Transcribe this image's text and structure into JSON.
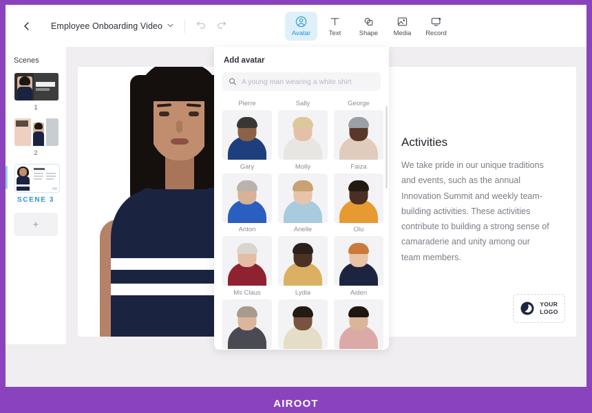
{
  "brand": {
    "name": "AIROOT",
    "frame_color": "#8a43bd"
  },
  "header": {
    "back_icon": "chevron-left-icon",
    "project_title": "Employee Onboarding Video",
    "title_chevron": "chevron-down-icon",
    "undo_icon": "undo-icon",
    "redo_icon": "redo-icon",
    "tools": [
      {
        "label": "Avatar",
        "icon": "avatar-icon",
        "active": true
      },
      {
        "label": "Text",
        "icon": "text-icon",
        "active": false
      },
      {
        "label": "Shape",
        "icon": "shape-icon",
        "active": false
      },
      {
        "label": "Media",
        "icon": "media-icon",
        "active": false
      },
      {
        "label": "Record",
        "icon": "record-icon",
        "active": false
      }
    ],
    "accent_color": "#2b93d6",
    "active_tool_bg": "#dff0fb"
  },
  "scenes": {
    "title": "Scenes",
    "items": [
      {
        "label": "1",
        "active": false
      },
      {
        "label": "2",
        "active": false
      },
      {
        "label": "SCENE 3",
        "active": true
      }
    ],
    "add_label": "+",
    "add_icon": "plus-icon"
  },
  "panel": {
    "title": "Add avatar",
    "search": {
      "icon": "search-icon",
      "value": "",
      "placeholder": "A young man wearing a white shirt"
    },
    "avatars": [
      {
        "name": "Pierre",
        "skin": "#8d6247",
        "hair": "#3a3732",
        "shirt": "#1d3f7e"
      },
      {
        "name": "Sally",
        "skin": "#e5c0a8",
        "hair": "#dcc89a",
        "shirt": "#e8e6e2"
      },
      {
        "name": "George",
        "skin": "#59382a",
        "hair": "#9aa0a8",
        "shirt": "#e0cbbd"
      },
      {
        "name": "Gary",
        "skin": "#d8b196",
        "hair": "#b9b3ab",
        "shirt": "#2a5fc0"
      },
      {
        "name": "Molly",
        "skin": "#e6c3a9",
        "hair": "#c9a172",
        "shirt": "#a8cbe0"
      },
      {
        "name": "Faiza",
        "skin": "#4a3024",
        "hair": "#241a14",
        "shirt": "#e89a32"
      },
      {
        "name": "Anton",
        "skin": "#e3bda4",
        "hair": "#d9d4d0",
        "shirt": "#8e2230"
      },
      {
        "name": "Arielle",
        "skin": "#4b3226",
        "hair": "#2a211c",
        "shirt": "#dcb063"
      },
      {
        "name": "Olu",
        "skin": "#e8c3a6",
        "hair": "#c97a3c",
        "shirt": "#1c2440"
      },
      {
        "name": "Ms Claus",
        "skin": "#dbb69d",
        "hair": "#a89a8c",
        "shirt": "#4a4a52"
      },
      {
        "name": "Lydia",
        "skin": "#7a5340",
        "hair": "#241a14",
        "shirt": "#e6ddc8"
      },
      {
        "name": "Aiden",
        "skin": "#dcb49a",
        "hair": "#1d1712",
        "shirt": "#dcaaa6"
      }
    ]
  },
  "canvas": {
    "heading": "Activities",
    "body": "We take pride in our unique traditions and events, such as the annual Innovation Summit and weekly team-building activities. These activities contribute to building a strong sense of camaraderie and unity among our team members.",
    "logo": {
      "icon": "ring-logo-icon",
      "line1": "YOUR",
      "line2": "LOGO"
    }
  }
}
